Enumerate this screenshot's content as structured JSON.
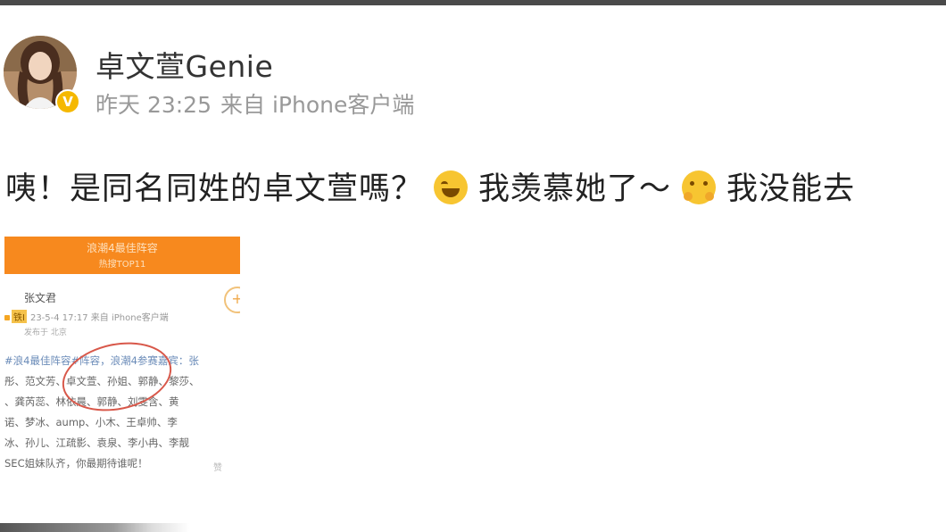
{
  "user": {
    "name": "卓文萱Genie",
    "time": "昨天 23:25",
    "source": "来自 iPhone客户端"
  },
  "post": {
    "text_1": "咦！是同名同姓的卓文萱嗎？",
    "emoji_1": "laugh-cry-emoji",
    "text_2": "我羡慕她了～",
    "emoji_2": "hug-emoji",
    "text_3": "我没能去"
  },
  "embedded_screenshot": {
    "banner_title": "浪潮4最佳阵容",
    "banner_subtitle": "热搜TOP11",
    "author": "张文君",
    "author_tag": "铁Ⅰ",
    "author_meta": "23-5-4 17:17 来自 iPhone客户端",
    "author_location": "发布于 北京",
    "body_lines": [
      "#浪4最佳阵容#阵容，浪潮4参赛嘉宾：张",
      "彤、范文芳、卓文萱、孙姐、郭静、黎莎、",
      "、龚芮蕊、林依晨、郭静、刘雯含、黄",
      "诺、梦冰、aump、小木、王卓帅、李",
      "冰、孙儿、江疏影、袁泉、李小冉、李靓",
      "SEC姐妹队齐，你最期待谁呢！"
    ],
    "like_label": "赞"
  }
}
